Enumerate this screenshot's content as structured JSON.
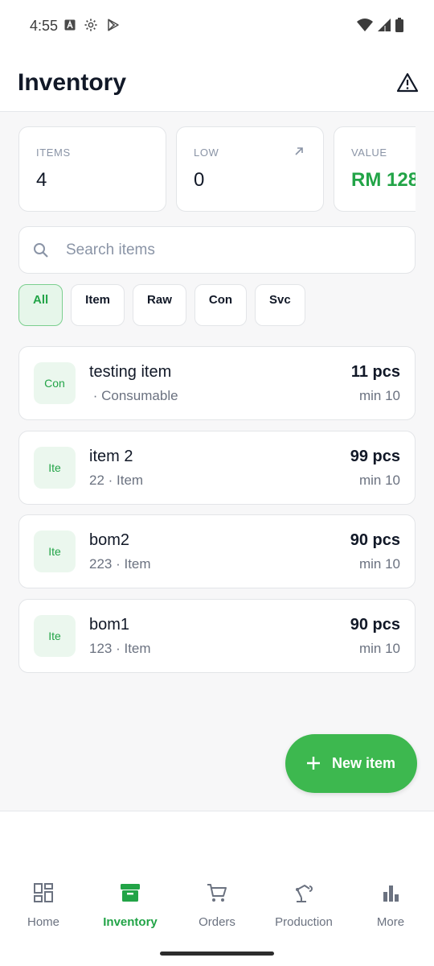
{
  "status_bar": {
    "time": "4:55",
    "left_icons": [
      "font-a-icon",
      "settings-gear-icon",
      "play-store-icon"
    ],
    "right_icons": [
      "wifi-icon",
      "signal-icon",
      "battery-icon"
    ]
  },
  "header": {
    "title": "Inventory",
    "alert_icon": "warning-triangle-icon"
  },
  "stats": [
    {
      "label": "ITEMS",
      "value": "4"
    },
    {
      "label": "LOW",
      "value": "0",
      "icon": "arrow-up-right-icon"
    },
    {
      "label": "VALUE",
      "value": "RM 128"
    }
  ],
  "search": {
    "placeholder": "Search items",
    "value": ""
  },
  "filters": {
    "chips": [
      "All",
      "Item",
      "Raw",
      "Con",
      "Svc"
    ],
    "selected": "All"
  },
  "items": [
    {
      "badge": "Con",
      "name": "testing item",
      "sub": " · Consumable",
      "qty": "11 pcs",
      "min": "min 10"
    },
    {
      "badge": "Ite",
      "name": "item 2",
      "sub": "22 · Item",
      "qty": "99 pcs",
      "min": "min 10"
    },
    {
      "badge": "Ite",
      "name": "bom2",
      "sub": "223 · Item",
      "qty": "90 pcs",
      "min": "min 10"
    },
    {
      "badge": "Ite",
      "name": "bom1",
      "sub": "123 · Item",
      "qty": "90 pcs",
      "min": "min 10"
    }
  ],
  "fab": {
    "label": "New item",
    "icon": "plus-icon"
  },
  "bottom_nav": {
    "items": [
      {
        "label": "Home",
        "icon": "dashboard-grid-icon"
      },
      {
        "label": "Inventory",
        "icon": "archive-box-icon",
        "active": true
      },
      {
        "label": "Orders",
        "icon": "shopping-cart-icon"
      },
      {
        "label": "Production",
        "icon": "robot-arm-icon"
      },
      {
        "label": "More",
        "icon": "bar-chart-icon"
      }
    ]
  },
  "colors": {
    "accent": "#22a447",
    "fab": "#3db84f",
    "chip_active_bg": "#e6f6ea",
    "badge_bg": "#ebf7ee"
  }
}
